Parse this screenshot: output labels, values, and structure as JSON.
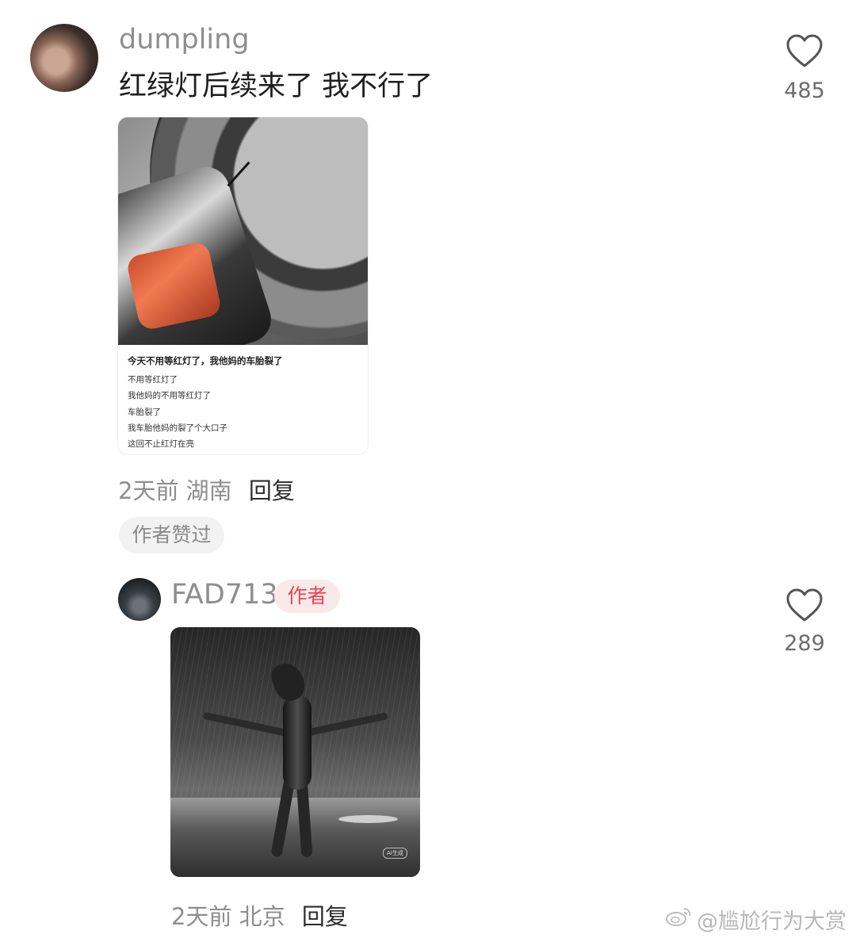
{
  "comment": {
    "username": "dumpling",
    "text": "红绿灯后续来了 我不行了",
    "likes": "485",
    "image": {
      "caption_title": "今天不用等红灯了，我他妈的车胎裂了",
      "caption_lines": [
        "不用等红灯了",
        "我他妈的不用等红灯了",
        "车胎裂了",
        "我车胎他妈的裂了个大口子",
        "这回不止红灯在亮"
      ]
    },
    "time": "2天前",
    "location": "湖南",
    "reply_label": "回复",
    "author_liked_badge": "作者赞过"
  },
  "reply": {
    "username": "FAD713",
    "author_tag": "作者",
    "likes": "289",
    "image": {
      "watermark": "AI生成"
    },
    "time": "2天前",
    "location": "北京",
    "reply_label": "回复"
  },
  "watermark": {
    "text": "@尴尬行为大赏",
    "icon": "weibo-icon"
  },
  "colors": {
    "author_tag_text": "#e9444f",
    "author_tag_bg": "#fbe9ea",
    "username": "#8e8e8e",
    "meta_text": "#8e8e8e"
  }
}
